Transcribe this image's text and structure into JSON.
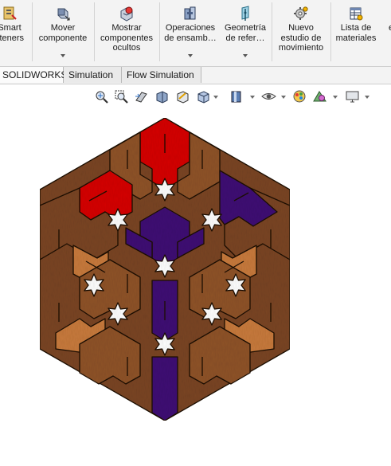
{
  "ribbon": {
    "buttons": [
      {
        "label": "Smart\nsteners",
        "icon": "smart-fasteners-icon"
      },
      {
        "label": "Mover\ncomponente",
        "icon": "move-component-icon"
      },
      {
        "label": "Mostrar\ncomponentes\nocultos",
        "icon": "show-hidden-components-icon"
      },
      {
        "label": "Operaciones\nde ensamb…",
        "icon": "assembly-features-icon"
      },
      {
        "label": "Geometría\nde refer…",
        "icon": "reference-geometry-icon"
      },
      {
        "label": "Nuevo\nestudio de\nmovimiento",
        "icon": "new-motion-study-icon"
      },
      {
        "label": "Lista de\nmateriales",
        "icon": "bill-of-materials-icon"
      },
      {
        "label": "e",
        "icon": "clipped-button-icon"
      }
    ]
  },
  "tabs": [
    "SOLIDWORKS",
    "Simulation",
    "Flow Simulation"
  ],
  "hud_icons": [
    "zoom-to-fit-icon",
    "zoom-to-area-icon",
    "previous-view-icon",
    "section-view-icon",
    "dynamic-annotation-icon",
    "view-orientation-icon",
    "display-style-icon",
    "hide-show-items-icon",
    "edit-appearance-icon",
    "apply-scene-icon",
    "view-settings-icon"
  ],
  "colors": {
    "ribbon_bg": "#f3f3f3",
    "wood_dark": "#7a4522",
    "wood_mid": "#8f5328",
    "wood_light": "#c87a3c",
    "red": "#d60000",
    "purple": "#3f0f74",
    "edge": "#1c1006"
  }
}
